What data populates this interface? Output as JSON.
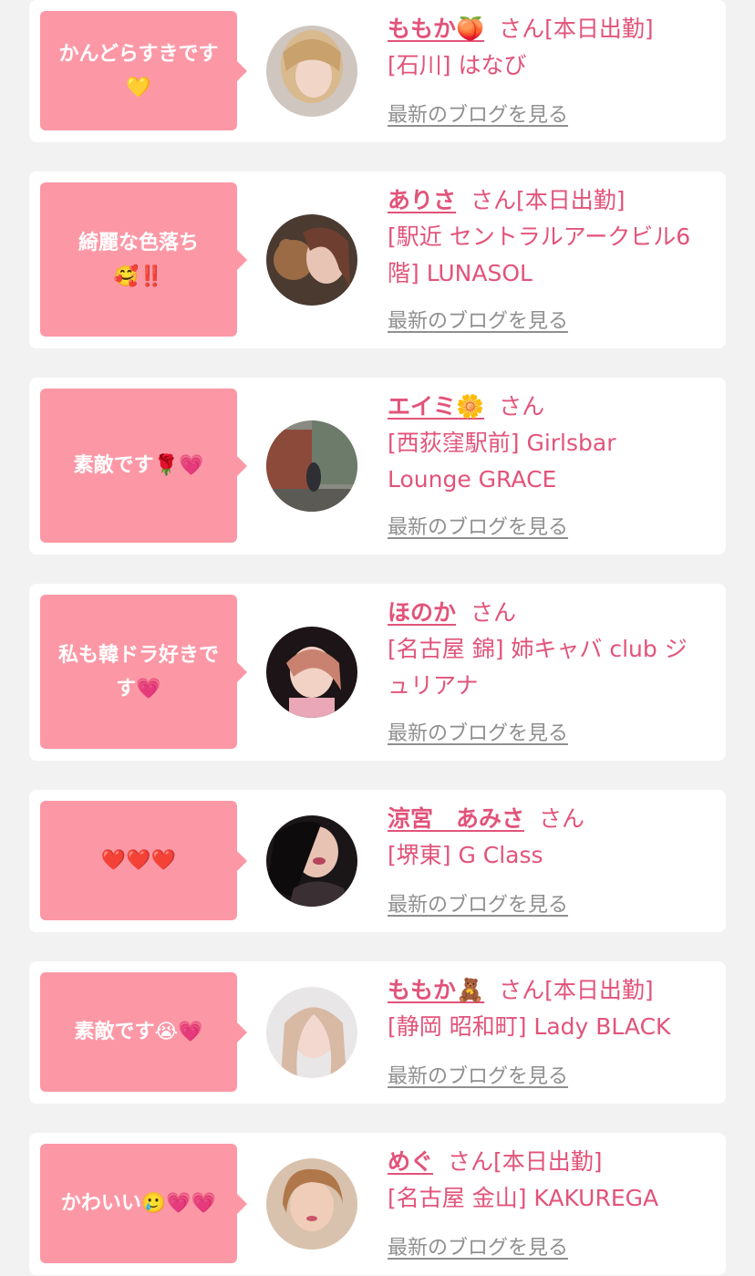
{
  "colors": {
    "background": "#f2f2f2",
    "card": "#ffffff",
    "bubble": "#fc98a6",
    "accent": "#e2537a",
    "link_gray": "#8f8f8f"
  },
  "entries": [
    {
      "comment_lines": [
        "かんどらすきです",
        "💛"
      ],
      "name": "ももか🍑",
      "suffix": "さん[本日出勤]",
      "shop_lines": [
        "[石川] はなび"
      ],
      "blog_link": "最新のブログを見る",
      "avatar_icon": "avatar-photo"
    },
    {
      "comment_lines": [
        "綺麗な色落ち",
        "🥰‼️"
      ],
      "name": "ありさ",
      "suffix": "さん[本日出勤]",
      "shop_lines": [
        "[駅近 セントラルアークビル6",
        "階] LUNASOL"
      ],
      "blog_link": "最新のブログを見る",
      "avatar_icon": "avatar-photo"
    },
    {
      "comment_lines": [
        "素敵です🌹💗"
      ],
      "name": "エイミ🌼",
      "suffix": "さん",
      "shop_lines": [
        "[西荻窪駅前] Girlsbar",
        "Lounge GRACE"
      ],
      "blog_link": "最新のブログを見る",
      "avatar_icon": "avatar-photo"
    },
    {
      "comment_lines": [
        "私も韓ドラ好きで",
        "す💗"
      ],
      "name": "ほのか",
      "suffix": "さん",
      "shop_lines": [
        "[名古屋 錦] 姉キャバ club ジ",
        "ュリアナ"
      ],
      "blog_link": "最新のブログを見る",
      "avatar_icon": "avatar-photo"
    },
    {
      "comment_lines": [
        "❤️❤️❤️"
      ],
      "name": "涼宮　あみさ",
      "suffix": "さん",
      "shop_lines": [
        "[堺東] G Class"
      ],
      "blog_link": "最新のブログを見る",
      "avatar_icon": "avatar-photo"
    },
    {
      "comment_lines": [
        "素敵です😭💗"
      ],
      "name": "ももか🧸",
      "suffix": "さん[本日出勤]",
      "shop_lines": [
        "[静岡 昭和町] Lady BLACK"
      ],
      "blog_link": "最新のブログを見る",
      "avatar_icon": "avatar-photo"
    },
    {
      "comment_lines": [
        "かわいい🥲💗💗"
      ],
      "name": "めぐ",
      "suffix": "さん[本日出勤]",
      "shop_lines": [
        "[名古屋 金山] KAKUREGA"
      ],
      "blog_link": "最新のブログを見る",
      "avatar_icon": "avatar-photo"
    }
  ]
}
